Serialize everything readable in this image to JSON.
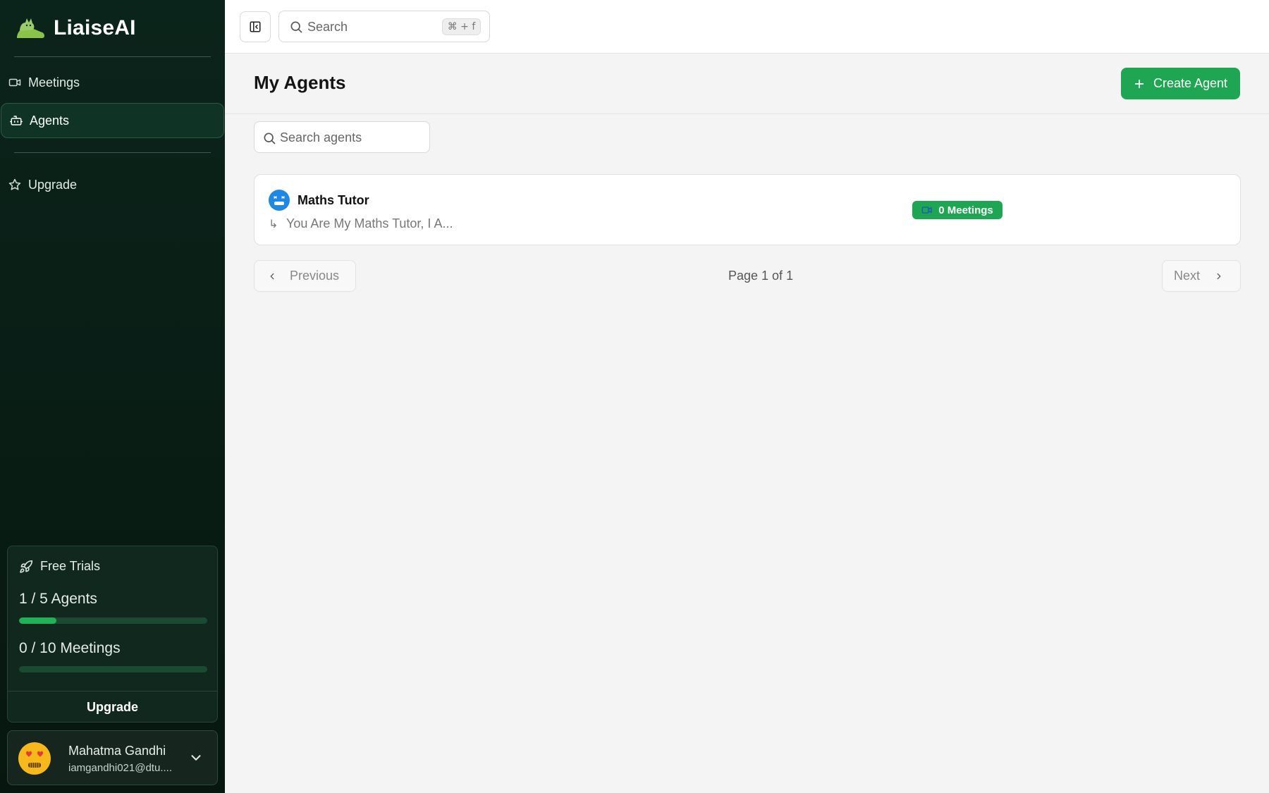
{
  "app": {
    "name": "LiaiseAI"
  },
  "sidebar": {
    "items": [
      {
        "label": "Meetings",
        "icon": "video-icon"
      },
      {
        "label": "Agents",
        "icon": "bot-icon",
        "active": true
      },
      {
        "label": "Upgrade",
        "icon": "star-icon"
      }
    ],
    "trial": {
      "title": "Free Trials",
      "agents_label": "1 / 5 Agents",
      "agents_progress": 0.2,
      "meetings_label": "0 / 10 Meetings",
      "meetings_progress": 0,
      "upgrade_label": "Upgrade"
    },
    "user": {
      "name": "Mahatma Gandhi",
      "email": "iamgandhi021@dtu...."
    }
  },
  "topbar": {
    "search_placeholder": "Search",
    "shortcut": "⌘ + f"
  },
  "page": {
    "title": "My Agents",
    "create_label": "Create Agent",
    "search_placeholder": "Search agents"
  },
  "agents": [
    {
      "name": "Maths Tutor",
      "description": "You Are My Maths Tutor, I A...",
      "meetings_label": "0 Meetings"
    }
  ],
  "pagination": {
    "previous_label": "Previous",
    "next_label": "Next",
    "page_info": "Page 1 of 1"
  },
  "colors": {
    "sidebar_bg": "#0b241b",
    "accent": "#1ea653",
    "progress": "#1fb256"
  }
}
